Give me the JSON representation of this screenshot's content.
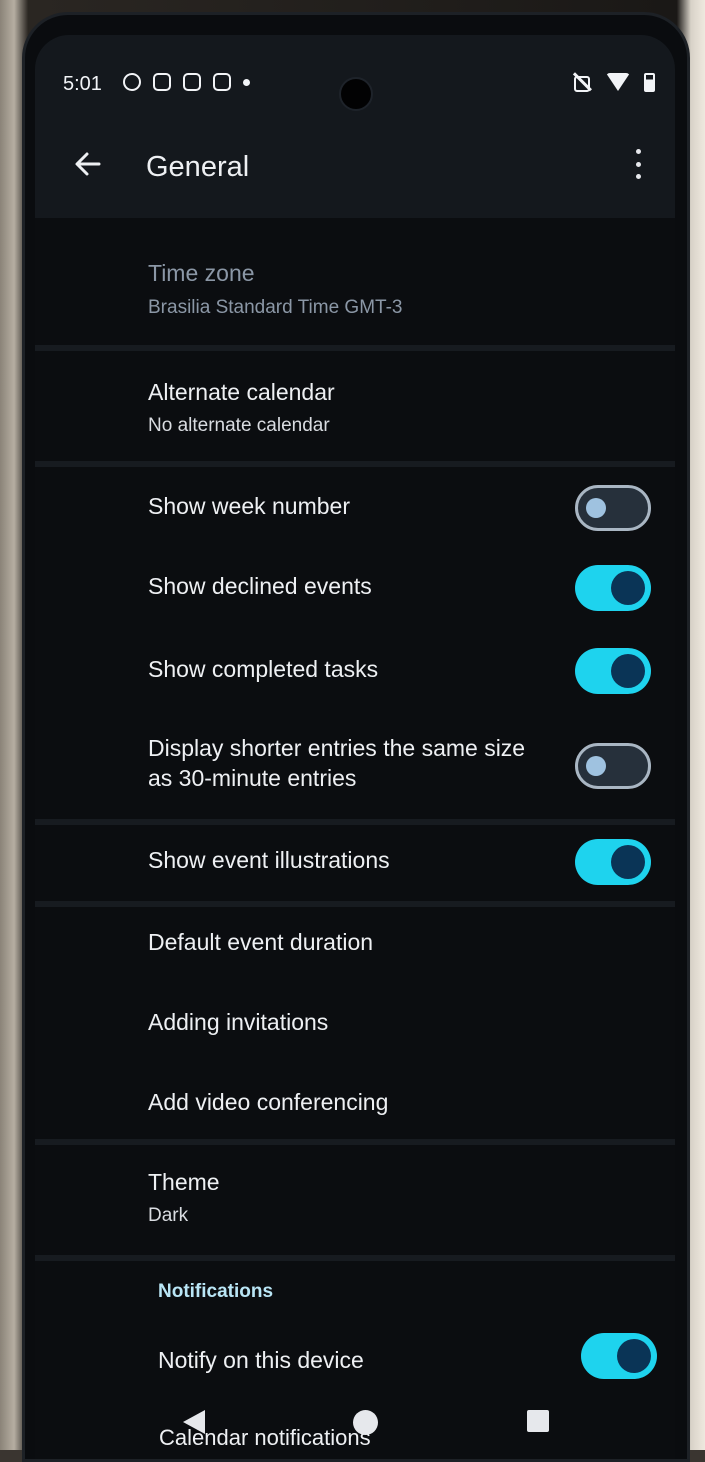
{
  "status_bar": {
    "time": "5:01",
    "left_icons": [
      "app-notification-icon",
      "sim-icon",
      "bag-icon",
      "message-icon",
      "more-dot-icon"
    ],
    "right_icons": [
      "mute-icon",
      "wifi-icon",
      "battery-icon"
    ]
  },
  "app_bar": {
    "title": "General",
    "back_icon": "back-arrow-icon",
    "menu_icon": "more-vertical-icon"
  },
  "settings": [
    {
      "id": "time-zone",
      "title": "Time zone",
      "subtitle": "Brasilia Standard Time  GMT-3",
      "enabled": false
    },
    {
      "id": "alternate-calendar",
      "title": "Alternate calendar",
      "subtitle": "No alternate calendar"
    },
    {
      "id": "show-week-number",
      "title": "Show week number",
      "toggle": false
    },
    {
      "id": "show-declined-events",
      "title": "Show declined events",
      "toggle": true
    },
    {
      "id": "show-completed-tasks",
      "title": "Show completed tasks",
      "toggle": true
    },
    {
      "id": "display-shorter-entries",
      "title": "Display shorter entries the same size",
      "title_line2": "as 30-minute entries",
      "toggle": false
    },
    {
      "id": "show-event-illustrations",
      "title": "Show event illustrations",
      "toggle": true
    },
    {
      "id": "default-event-duration",
      "title": "Default event duration"
    },
    {
      "id": "adding-invitations",
      "title": "Adding invitations"
    },
    {
      "id": "add-video-conferencing",
      "title": "Add video conferencing"
    },
    {
      "id": "theme",
      "title": "Theme",
      "subtitle": "Dark"
    }
  ],
  "notifications_section": {
    "header": "Notifications",
    "items": [
      {
        "id": "notify-on-this-device",
        "title": "Notify on this device",
        "toggle": true
      },
      {
        "id": "calendar-notifications",
        "title": "Calendar notifications"
      }
    ]
  },
  "colors": {
    "toggle_on": "#1ed3ee",
    "toggle_knob_on": "#0a3456",
    "toggle_off_track": "#26303b",
    "background": "#0b0d10",
    "section_header": "#b9e5f5"
  },
  "nav_bar": [
    "nav-back-icon",
    "nav-home-icon",
    "nav-recents-icon"
  ]
}
